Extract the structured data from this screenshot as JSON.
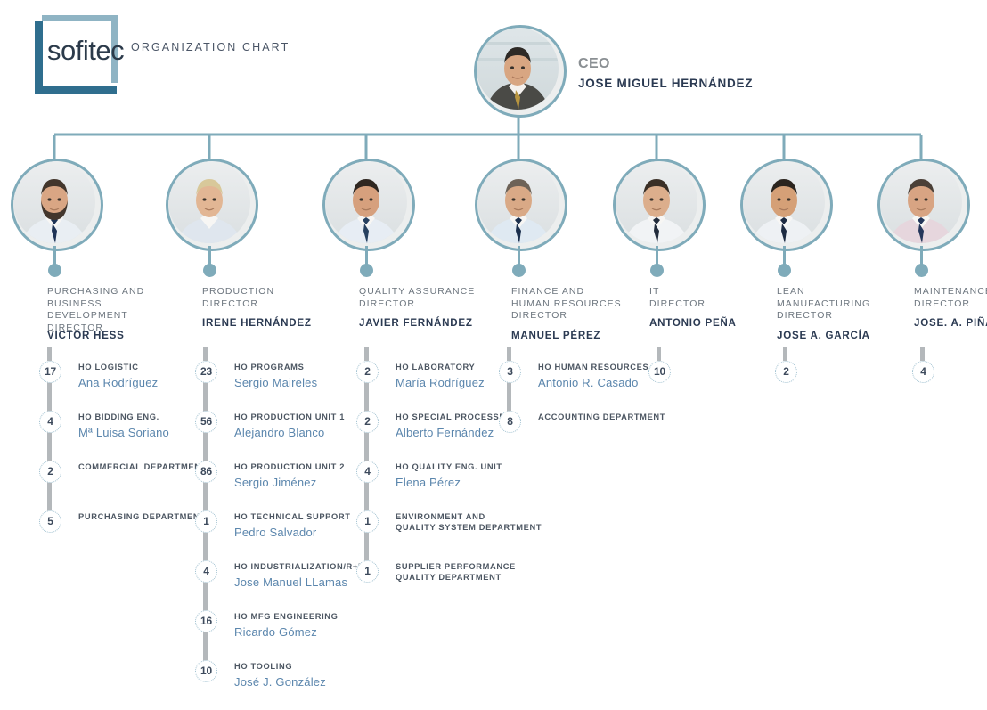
{
  "header": {
    "logo_wordmark": "sofitec",
    "title": "ORGANIZATION CHART"
  },
  "colors": {
    "ring": "#7fabba",
    "rail": "#b4b8bb",
    "bubble_border": "#9fc0d0",
    "name_blue": "#5b86ad",
    "role_gray": "#6c757e",
    "dark_navy": "#2b3a52",
    "logo_dark": "#2f6e8e",
    "logo_light": "#8fb4c4"
  },
  "ceo": {
    "role": "CEO",
    "name": "JOSE MIGUEL HERNÁNDEZ"
  },
  "columns": [
    {
      "role": "PURCHASING AND\nBUSINESS DEVELOPMENT\nDIRECTOR",
      "role_lines": [
        "PURCHASING AND",
        "BUSINESS DEVELOPMENT",
        "DIRECTOR"
      ],
      "name": "VICTOR HESS",
      "items": [
        {
          "count": "17",
          "role": "HO LOGISTIC",
          "name": "Ana Rodríguez"
        },
        {
          "count": "4",
          "role": "HO BIDDING ENG.",
          "name": "Mª Luisa Soriano"
        },
        {
          "count": "2",
          "role": "COMMERCIAL DEPARTMENT",
          "name": ""
        },
        {
          "count": "5",
          "role": "PURCHASING DEPARTMENT",
          "name": ""
        }
      ]
    },
    {
      "role_lines": [
        "PRODUCTION",
        "DIRECTOR"
      ],
      "name": "IRENE HERNÁNDEZ",
      "items": [
        {
          "count": "23",
          "role": "HO PROGRAMS",
          "name": "Sergio Maireles"
        },
        {
          "count": "56",
          "role": "HO PRODUCTION UNIT 1",
          "name": "Alejandro Blanco"
        },
        {
          "count": "86",
          "role": "HO PRODUCTION UNIT 2",
          "name": "Sergio Jiménez"
        },
        {
          "count": "1",
          "role": "HO TECHNICAL SUPPORT",
          "name": "Pedro Salvador"
        },
        {
          "count": "4",
          "role": "HO INDUSTRIALIZATION/R+D",
          "name": "Jose Manuel LLamas"
        },
        {
          "count": "16",
          "role": "HO MFG ENGINEERING",
          "name": "Ricardo Gómez"
        },
        {
          "count": "10",
          "role": "HO TOOLING",
          "name": "José J. González"
        }
      ]
    },
    {
      "role_lines": [
        "QUALITY ASSURANCE",
        "DIRECTOR"
      ],
      "name": "JAVIER FERNÁNDEZ",
      "items": [
        {
          "count": "2",
          "role": "HO LABORATORY",
          "name": "María Rodríguez"
        },
        {
          "count": "2",
          "role": "HO SPECIAL PROCESSES",
          "name": "Alberto Fernández"
        },
        {
          "count": "4",
          "role": "HO QUALITY ENG. UNIT",
          "name": "Elena Pérez"
        },
        {
          "count": "1",
          "role": "ENVIRONMENT AND\nQUALITY SYSTEM DEPARTMENT",
          "name": ""
        },
        {
          "count": "1",
          "role": "SUPPLIER PERFORMANCE\nQUALITY DEPARTMENT",
          "name": ""
        }
      ]
    },
    {
      "role_lines": [
        "FINANCE AND",
        "HUMAN RESOURCES",
        "DIRECTOR"
      ],
      "name": "MANUEL PÉREZ",
      "items": [
        {
          "count": "3",
          "role": "HO HUMAN RESOURCES",
          "name": "Antonio R. Casado"
        },
        {
          "count": "8",
          "role": "ACCOUNTING DEPARTMENT",
          "name": ""
        }
      ]
    },
    {
      "role_lines": [
        "IT",
        "DIRECTOR"
      ],
      "name": "ANTONIO PEÑA",
      "items": [
        {
          "count": "10",
          "role": "",
          "name": ""
        }
      ]
    },
    {
      "role_lines": [
        "LEAN",
        "MANUFACTURING",
        "DIRECTOR"
      ],
      "name": "JOSE A. GARCÍA",
      "items": [
        {
          "count": "2",
          "role": "",
          "name": ""
        }
      ]
    },
    {
      "role_lines": [
        "MAINTENANCE",
        "DIRECTOR"
      ],
      "name": "JOSE. A. PIÑA",
      "items": [
        {
          "count": "4",
          "role": "",
          "name": ""
        }
      ]
    }
  ]
}
